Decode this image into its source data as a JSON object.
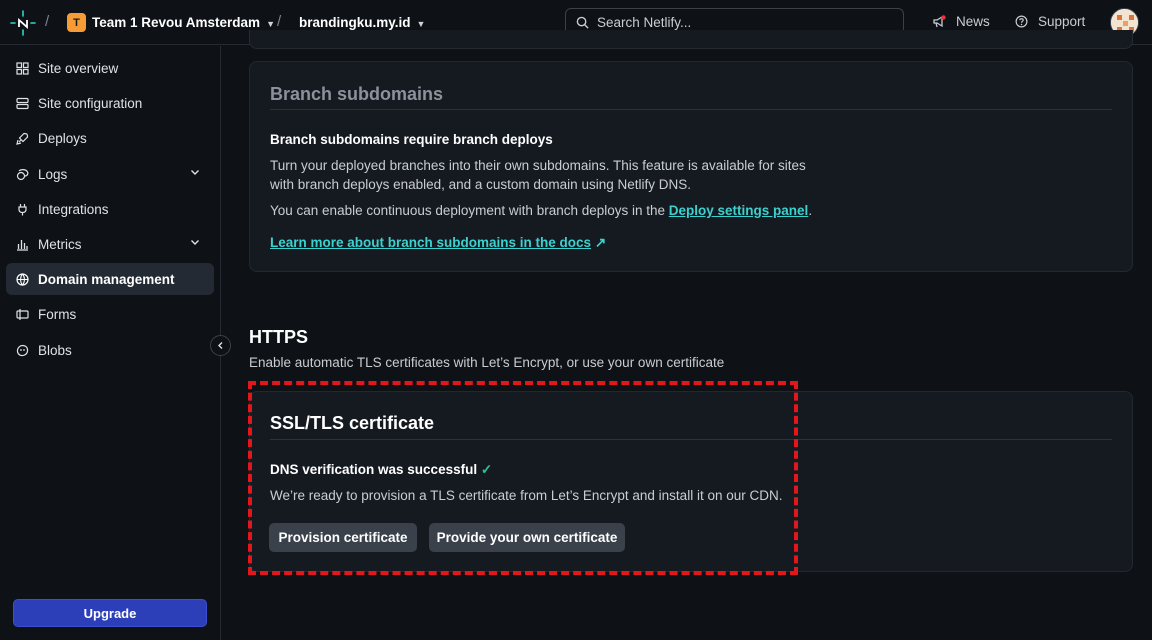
{
  "header": {
    "team_badge": "T",
    "team_name": "Team 1 Revou Amsterdam",
    "site_name": "brandingku.my.id",
    "search_placeholder": "Search Netlify...",
    "news_label": "News",
    "support_label": "Support"
  },
  "sidebar": {
    "items": [
      {
        "label": "Site overview",
        "icon": "grid-icon"
      },
      {
        "label": "Site configuration",
        "icon": "settings-list-icon"
      },
      {
        "label": "Deploys",
        "icon": "rocket-icon"
      },
      {
        "label": "Logs",
        "icon": "logs-icon"
      },
      {
        "label": "Integrations",
        "icon": "plug-icon"
      },
      {
        "label": "Metrics",
        "icon": "bar-chart-icon"
      },
      {
        "label": "Domain management",
        "icon": "globe-icon",
        "active": true
      },
      {
        "label": "Forms",
        "icon": "form-icon"
      },
      {
        "label": "Blobs",
        "icon": "blob-icon"
      }
    ],
    "upgrade_label": "Upgrade"
  },
  "branch_card": {
    "title": "Branch subdomains",
    "subtitle": "Branch subdomains require branch deploys",
    "desc_line1": "Turn your deployed branches into their own subdomains. This feature is available for sites",
    "desc_line2": "with branch deploys enabled, and a custom domain using Netlify DNS.",
    "deploy_text_prefix": "You can enable continuous deployment with branch deploys in the ",
    "deploy_link": "Deploy settings panel",
    "deploy_text_suffix": ".",
    "docs_link": "Learn more about branch subdomains in the docs",
    "docs_arrow": "↗"
  },
  "https": {
    "title": "HTTPS",
    "subtitle": "Enable automatic TLS certificates with Let’s Encrypt, or use your own certificate"
  },
  "ssl_card": {
    "title": "SSL/TLS certificate",
    "status": "DNS verification was successful",
    "status_check": "✓",
    "desc": "We’re ready to provision a TLS certificate from Let’s Encrypt and install it on our CDN.",
    "provision_button": "Provision certificate",
    "own_cert_button": "Provide your own certificate"
  },
  "colors": {
    "accent_link": "#3ad1cf",
    "upgrade": "#2c3fb8",
    "highlight": "#e3161c",
    "success": "#30c48d"
  }
}
